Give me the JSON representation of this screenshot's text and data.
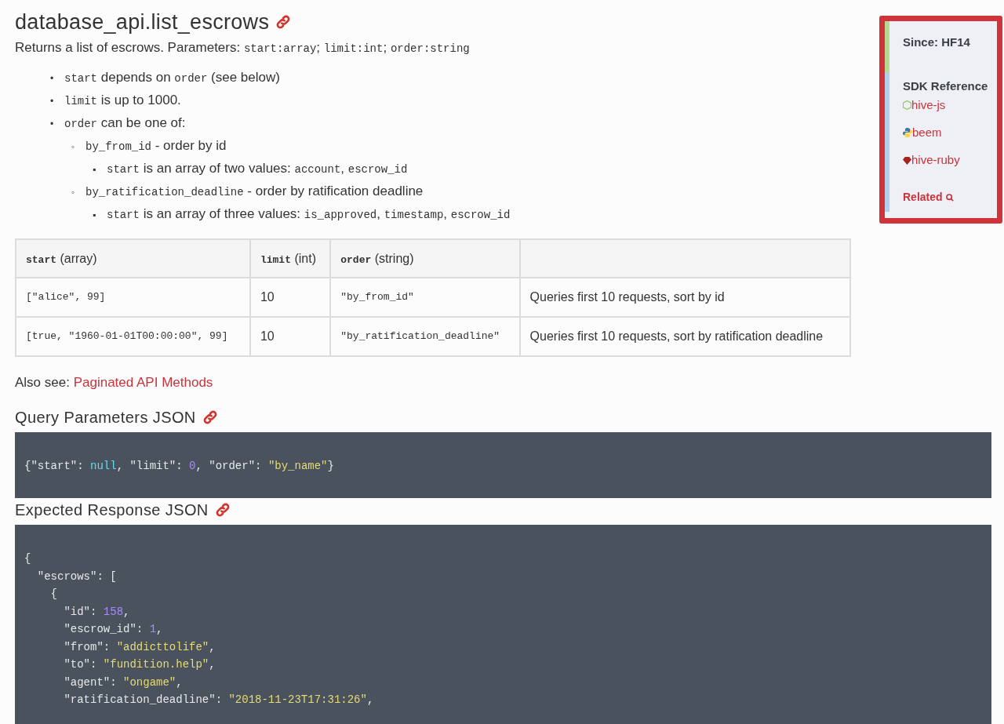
{
  "title": "database_api.list_escrows",
  "intro": [
    {
      "kind": "text",
      "text": "Returns a list of escrows. Parameters: "
    },
    {
      "kind": "code",
      "text": "start:array"
    },
    {
      "kind": "text",
      "text": "; "
    },
    {
      "kind": "code",
      "text": "limit:int"
    },
    {
      "kind": "text",
      "text": "; "
    },
    {
      "kind": "code",
      "text": "order:string"
    }
  ],
  "bullets": [
    {
      "marker": "•",
      "parts": [
        {
          "kind": "code",
          "text": "start"
        },
        {
          "kind": "text",
          "text": " depends on "
        },
        {
          "kind": "code",
          "text": "order"
        },
        {
          "kind": "text",
          "text": " (see below)"
        }
      ]
    },
    {
      "marker": "•",
      "parts": [
        {
          "kind": "code",
          "text": "limit"
        },
        {
          "kind": "text",
          "text": " is up to 1000."
        }
      ]
    },
    {
      "marker": "•",
      "parts": [
        {
          "kind": "code",
          "text": "order"
        },
        {
          "kind": "text",
          "text": " can be one of:"
        }
      ],
      "children": [
        {
          "marker": "◦",
          "parts": [
            {
              "kind": "code",
              "text": "by_from_id"
            },
            {
              "kind": "text",
              "text": " - order by id"
            }
          ],
          "children": [
            {
              "marker": "▪",
              "parts": [
                {
                  "kind": "code",
                  "text": "start"
                },
                {
                  "kind": "text",
                  "text": " is an array of two values: "
                },
                {
                  "kind": "code",
                  "text": "account"
                },
                {
                  "kind": "text",
                  "text": ", "
                },
                {
                  "kind": "code",
                  "text": "escrow_id"
                }
              ]
            }
          ]
        },
        {
          "marker": "◦",
          "parts": [
            {
              "kind": "code",
              "text": "by_ratification_deadline"
            },
            {
              "kind": "text",
              "text": " - order by ratification deadline"
            }
          ],
          "children": [
            {
              "marker": "▪",
              "parts": [
                {
                  "kind": "code",
                  "text": "start"
                },
                {
                  "kind": "text",
                  "text": " is an array of three values: "
                },
                {
                  "kind": "code",
                  "text": "is_approved"
                },
                {
                  "kind": "text",
                  "text": ", "
                },
                {
                  "kind": "code",
                  "text": "timestamp"
                },
                {
                  "kind": "text",
                  "text": ", "
                },
                {
                  "kind": "code",
                  "text": "escrow_id"
                }
              ]
            }
          ]
        }
      ]
    }
  ],
  "table": {
    "columns": [
      {
        "code": "start",
        "label": " (array)"
      },
      {
        "code": "limit",
        "label": " (int)"
      },
      {
        "code": "order",
        "label": " (string)"
      },
      {}
    ],
    "rows": [
      [
        {
          "kind": "code",
          "text": "[\"alice\", 99]"
        },
        {
          "kind": "text",
          "text": "10"
        },
        {
          "kind": "code",
          "text": "\"by_from_id\""
        },
        {
          "kind": "text",
          "text": "Queries first 10 requests, sort by id"
        }
      ],
      [
        {
          "kind": "code",
          "text": "[true, \"1960-01-01T00:00:00\", 99]"
        },
        {
          "kind": "text",
          "text": "10"
        },
        {
          "kind": "code",
          "text": "\"by_ratification_deadline\""
        },
        {
          "kind": "text",
          "text": "Queries first 10 requests, sort by ratification deadline"
        }
      ]
    ]
  },
  "also_see": {
    "label": "Also see: ",
    "link": "Paginated API Methods"
  },
  "sections": [
    {
      "heading": "Query Parameters JSON",
      "lines": [
        [
          {
            "kind": "punct",
            "text": "{\"start\": "
          },
          {
            "kind": "null",
            "text": "null"
          },
          {
            "kind": "punct",
            "text": ", \"limit\": "
          },
          {
            "kind": "number",
            "text": "0"
          },
          {
            "kind": "punct",
            "text": ", \"order\": "
          },
          {
            "kind": "string",
            "text": "\"by_name\""
          },
          {
            "kind": "punct",
            "text": "}"
          }
        ]
      ]
    },
    {
      "heading": "Expected Response JSON",
      "lines": [
        [
          {
            "kind": "punct",
            "text": "{"
          }
        ],
        [
          {
            "kind": "punct",
            "text": "  \"escrows\": ["
          }
        ],
        [
          {
            "kind": "punct",
            "text": "    {"
          }
        ],
        [
          {
            "kind": "punct",
            "text": "      \"id\": "
          },
          {
            "kind": "number",
            "text": "158"
          },
          {
            "kind": "punct",
            "text": ","
          }
        ],
        [
          {
            "kind": "punct",
            "text": "      \"escrow_id\": "
          },
          {
            "kind": "number",
            "text": "1"
          },
          {
            "kind": "punct",
            "text": ","
          }
        ],
        [
          {
            "kind": "punct",
            "text": "      \"from\": "
          },
          {
            "kind": "string",
            "text": "\"addicttolife\""
          },
          {
            "kind": "punct",
            "text": ","
          }
        ],
        [
          {
            "kind": "punct",
            "text": "      \"to\": "
          },
          {
            "kind": "string",
            "text": "\"fundition.help\""
          },
          {
            "kind": "punct",
            "text": ","
          }
        ],
        [
          {
            "kind": "punct",
            "text": "      \"agent\": "
          },
          {
            "kind": "string",
            "text": "\"ongame\""
          },
          {
            "kind": "punct",
            "text": ","
          }
        ],
        [
          {
            "kind": "punct",
            "text": "      \"ratification_deadline\": "
          },
          {
            "kind": "string",
            "text": "\"2018-11-23T17:31:26\""
          },
          {
            "kind": "punct",
            "text": ","
          }
        ]
      ]
    }
  ],
  "sidebar": {
    "since": "Since: HF14",
    "sdk_heading": "SDK Reference",
    "sdks": [
      {
        "kind": "node",
        "label": "hive-js"
      },
      {
        "kind": "python",
        "label": "beem"
      },
      {
        "kind": "ruby",
        "label": "hive-ruby"
      }
    ],
    "related": "Related"
  }
}
